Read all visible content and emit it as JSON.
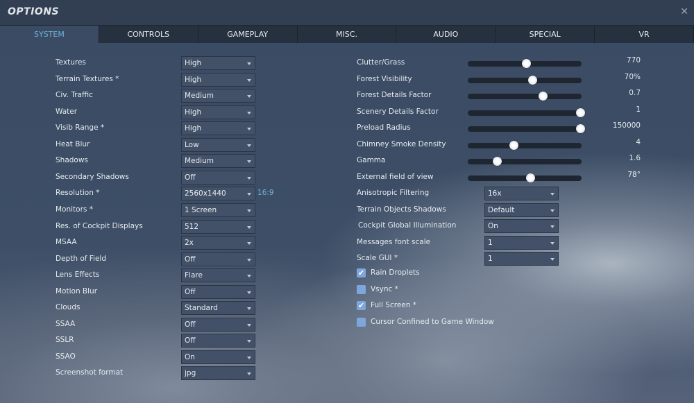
{
  "window": {
    "title": "OPTIONS",
    "close_icon": "close-icon"
  },
  "tabs": [
    {
      "label": "SYSTEM",
      "active": true
    },
    {
      "label": "CONTROLS"
    },
    {
      "label": "GAMEPLAY"
    },
    {
      "label": "MISC."
    },
    {
      "label": "AUDIO"
    },
    {
      "label": "SPECIAL"
    },
    {
      "label": "VR"
    }
  ],
  "left_settings": [
    {
      "label": "Textures",
      "value": "High"
    },
    {
      "label": "Terrain Textures *",
      "value": "High"
    },
    {
      "label": "Civ. Traffic",
      "value": "Medium"
    },
    {
      "label": "Water",
      "value": "High"
    },
    {
      "label": "Visib Range *",
      "value": "High"
    },
    {
      "label": "Heat Blur",
      "value": "Low"
    },
    {
      "label": "Shadows",
      "value": "Medium"
    },
    {
      "label": "Secondary Shadows",
      "value": "Off"
    },
    {
      "label": "Resolution *",
      "value": "2560x1440",
      "note": "16:9"
    },
    {
      "label": "Monitors *",
      "value": "1 Screen"
    },
    {
      "label": "Res. of Cockpit Displays",
      "value": "512"
    },
    {
      "label": "MSAA",
      "value": "2x"
    },
    {
      "label": "Depth of Field",
      "value": "Off"
    },
    {
      "label": "Lens Effects",
      "value": "Flare"
    },
    {
      "label": "Motion Blur",
      "value": "Off"
    },
    {
      "label": "Clouds",
      "value": "Standard"
    },
    {
      "label": "SSAA",
      "value": "Off"
    },
    {
      "label": "SSLR",
      "value": "Off"
    },
    {
      "label": "SSAO",
      "value": "On"
    },
    {
      "label": "Screenshot format",
      "value": "jpg"
    }
  ],
  "sliders": [
    {
      "label": "Clutter/Grass",
      "value": "770",
      "fraction": 0.51
    },
    {
      "label": "Forest Visibility",
      "value": "70%",
      "fraction": 0.57
    },
    {
      "label": "Forest Details Factor",
      "value": "0.7",
      "fraction": 0.66
    },
    {
      "label": "Scenery Details Factor",
      "value": "1",
      "fraction": 1.0
    },
    {
      "label": "Preload Radius",
      "value": "150000",
      "fraction": 1.0
    },
    {
      "label": "Chimney Smoke Density",
      "value": "4",
      "fraction": 0.4
    },
    {
      "label": "Gamma",
      "value": "1.6",
      "fraction": 0.25
    },
    {
      "label": "External field of view",
      "value": "78°",
      "fraction": 0.55
    }
  ],
  "right_dropdowns": [
    {
      "label": "Anisotropic Filtering",
      "value": "16x"
    },
    {
      "label": "Terrain Objects Shadows",
      "value": "Default"
    },
    {
      "label": "Cockpit Global Illumination",
      "value": "On"
    },
    {
      "label": "Messages font scale",
      "value": "1"
    },
    {
      "label": "Scale GUI *",
      "value": "1"
    }
  ],
  "checkboxes": [
    {
      "label": "Rain Droplets",
      "checked": true
    },
    {
      "label": "Vsync *",
      "checked": false
    },
    {
      "label": "Full Screen *",
      "checked": true
    },
    {
      "label": "Cursor Confined to Game Window",
      "checked": false
    }
  ]
}
